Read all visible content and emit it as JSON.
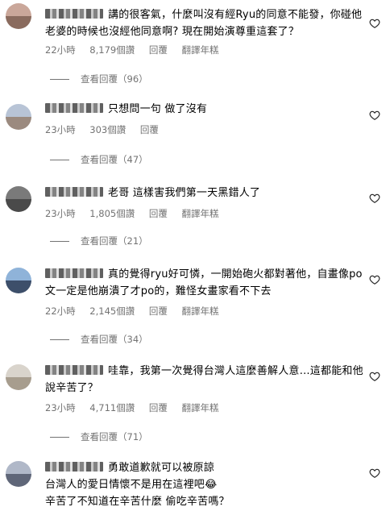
{
  "comments": [
    {
      "text": "講的很客氣，什麼叫沒有經Ryu的同意不能發，你碰他老婆的時候也沒經他同意啊? 現在開始演尊重這套了？",
      "time": "22小時",
      "likes": "8,179個讚",
      "reply": "回覆",
      "translate": "翻譯年糕",
      "view_replies": "查看回覆（96）"
    },
    {
      "text": "只想問一句 做了沒有",
      "time": "23小時",
      "likes": "303個讚",
      "reply": "回覆",
      "view_replies": "查看回覆（47）"
    },
    {
      "text": "老哥 這樣害我們第一天黑錯人了",
      "time": "23小時",
      "likes": "1,805個讚",
      "reply": "回覆",
      "translate": "翻譯年糕",
      "view_replies": "查看回覆（21）"
    },
    {
      "text": "真的覺得ryu好可憐，一開始砲火都對著他，自畫像po文一定是他崩潰了才po的，難怪女畫家看不下去",
      "time": "22小時",
      "likes": "2,145個讚",
      "reply": "回覆",
      "translate": "翻譯年糕",
      "view_replies": "查看回覆（34）"
    },
    {
      "text": "哇靠，我第一次覺得台灣人這麼善解人意…這都能和他說辛苦了？",
      "time": "23小時",
      "likes": "4,711個讚",
      "reply": "回覆",
      "translate": "翻譯年糕",
      "view_replies": "查看回覆（71）"
    },
    {
      "text_lines": [
        "勇敢道歉就可以被原諒",
        "台灣人的愛日情懷不是用在這裡吧😂",
        "辛苦了不知道在辛苦什麼 偷吃辛苦嗎？"
      ]
    }
  ]
}
